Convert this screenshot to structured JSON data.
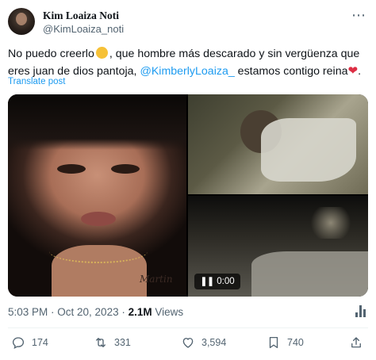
{
  "author": {
    "name": "Kim Loaiza Noti",
    "handle": "@KimLoaiza_noti"
  },
  "more_icon": "⋯",
  "tweet": {
    "part1": "No puedo creerlo",
    "part2": ", que hombre más descarado y sin vergüenza que eres juan de dios pantoja, ",
    "mention": "@KimberlyLoaiza_",
    "part3": " estamos contigo reina",
    "heart": "❤",
    "end": ".",
    "emoji_icon": "thinking-face-emoji"
  },
  "translate_label": "Translate post",
  "media": {
    "left_caption": "Martin",
    "video_duration": "0:00",
    "pause_icon": "❚❚"
  },
  "meta": {
    "time": "5:03 PM",
    "separator": " · ",
    "date": "Oct 20, 2023",
    "views_count": "2.1M",
    "views_label": " Views"
  },
  "actions": {
    "reply_count": "174",
    "retweet_count": "331",
    "like_count": "3,594",
    "bookmark_count": "740"
  },
  "colors": {
    "accent": "#1d9bf0",
    "secondary_text": "#536471",
    "heart": "#dd2e44"
  }
}
